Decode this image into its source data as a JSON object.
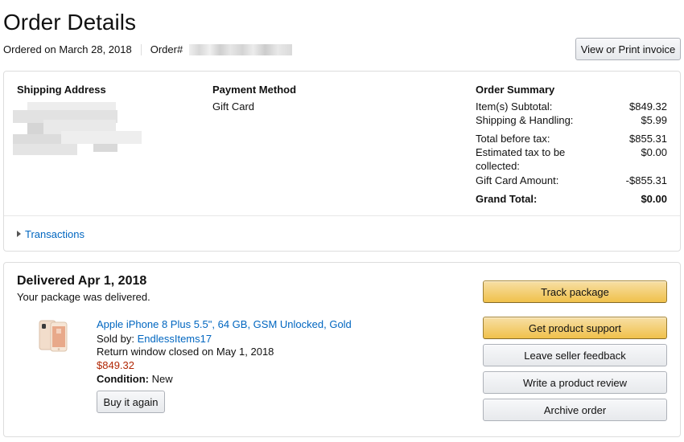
{
  "header": {
    "title": "Order Details",
    "ordered_on": "Ordered on March 28, 2018",
    "order_label": "Order#",
    "invoice_button": "View or Print invoice"
  },
  "summary": {
    "shipping_address_heading": "Shipping Address",
    "payment_method_heading": "Payment Method",
    "payment_method_value": "Gift Card",
    "order_summary_heading": "Order Summary",
    "rows": [
      {
        "label": "Item(s) Subtotal:",
        "value": "$849.32"
      },
      {
        "label": "Shipping & Handling:",
        "value": "$5.99"
      },
      {
        "label": "Total before tax:",
        "value": "$855.31"
      },
      {
        "label": "Estimated tax to be",
        "label2": "collected:",
        "value": "$0.00"
      },
      {
        "label": "Gift Card Amount:",
        "value": "-$855.31"
      },
      {
        "label": "Grand Total:",
        "value": "$0.00"
      }
    ],
    "transactions_link": "Transactions"
  },
  "shipment": {
    "status_title": "Delivered Apr 1, 2018",
    "status_sub": "Your package was delivered.",
    "product_title": "Apple iPhone 8 Plus 5.5\", 64 GB, GSM Unlocked, Gold",
    "sold_by_label": "Sold by: ",
    "seller": "EndlessItems17",
    "return_window": "Return window closed on May 1, 2018",
    "price": "$849.32",
    "condition_label": "Condition:",
    "condition_value": "New",
    "buy_again_button": "Buy it again",
    "actions": {
      "track": "Track package",
      "support": "Get product support",
      "seller_feedback": "Leave seller feedback",
      "review": "Write a product review",
      "archive": "Archive order"
    }
  },
  "colors": {
    "link": "#0066c0",
    "price": "#b12704",
    "primary_button": "#f0c14b",
    "border": "#dddddd"
  }
}
